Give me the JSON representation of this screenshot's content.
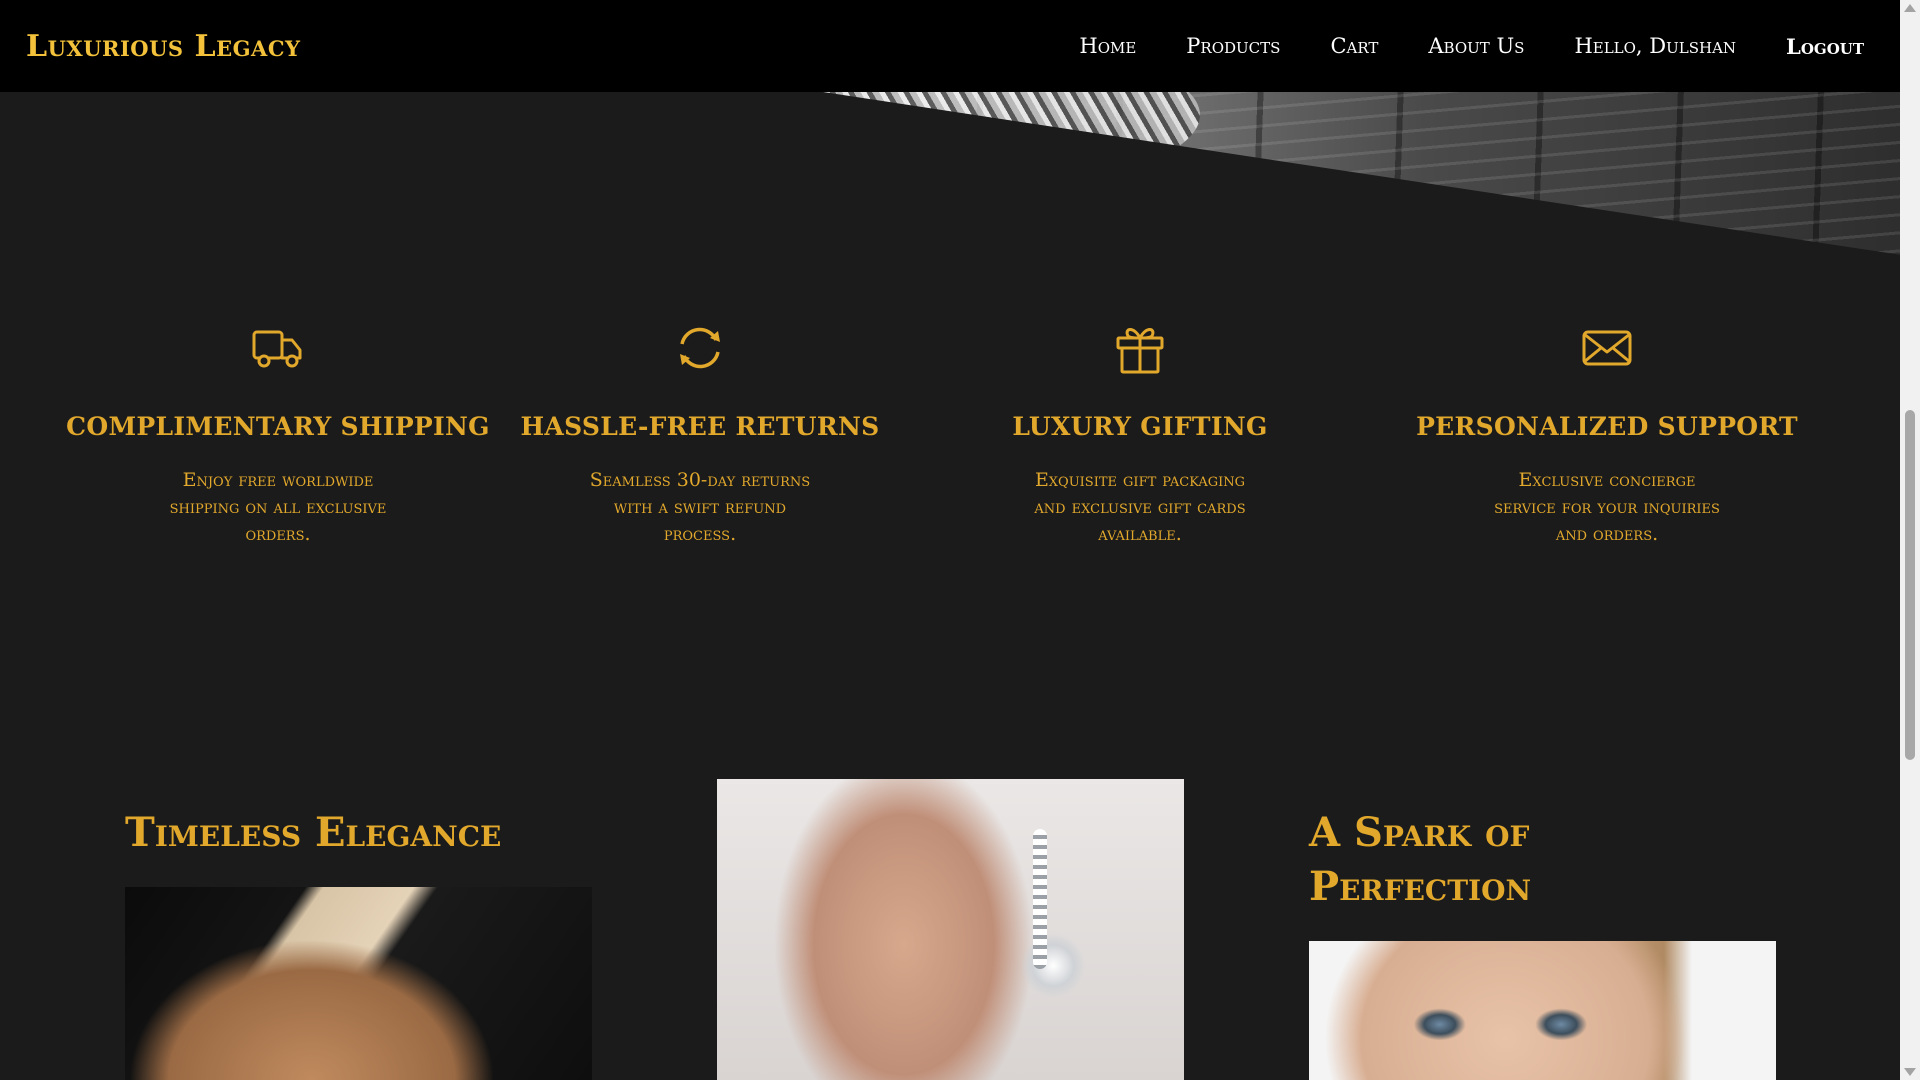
{
  "colors": {
    "background": "#1b1b1b",
    "navbar": "#000000",
    "brand": "#f3c23a",
    "accent_gold": "#e2a82c",
    "nav_text": "#ffffff"
  },
  "nav": {
    "brand": "Luxurious Legacy",
    "links": [
      {
        "label": "Home"
      },
      {
        "label": "Products"
      },
      {
        "label": "Cart"
      },
      {
        "label": "About Us"
      },
      {
        "label": "Hello, Dulshan"
      },
      {
        "label": "Logout"
      }
    ]
  },
  "features": [
    {
      "icon": "truck-icon",
      "title": "Complimentary Shipping",
      "description": "Enjoy free worldwide shipping on all exclusive orders."
    },
    {
      "icon": "refresh-icon",
      "title": "Hassle-Free Returns",
      "description": "Seamless 30-day returns with a swift refund process."
    },
    {
      "icon": "gift-icon",
      "title": "Luxury Gifting",
      "description": "Exquisite gift packaging and exclusive gift cards available."
    },
    {
      "icon": "envelope-icon",
      "title": "Personalized Support",
      "description": "Exclusive concierge service for your inquiries and orders."
    }
  ],
  "showcase": {
    "left_title": "Timeless Elegance",
    "right_title": "A Spark of Perfection"
  }
}
